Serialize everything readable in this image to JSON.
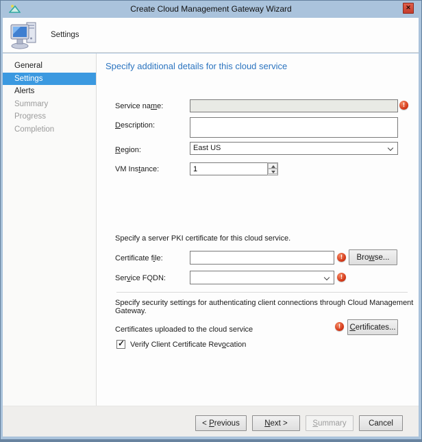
{
  "window": {
    "title": "Create Cloud Management Gateway Wizard"
  },
  "header": {
    "title": "Settings"
  },
  "sidebar": {
    "items": [
      {
        "label": "General",
        "state": "enabled"
      },
      {
        "label": "Settings",
        "state": "selected"
      },
      {
        "label": "Alerts",
        "state": "enabled"
      },
      {
        "label": "Summary",
        "state": "disabled"
      },
      {
        "label": "Progress",
        "state": "disabled"
      },
      {
        "label": "Completion",
        "state": "disabled"
      }
    ]
  },
  "content": {
    "heading": "Specify additional details for this cloud service",
    "rows": {
      "service_name": {
        "label": {
          "text": "Service name:",
          "u": 10
        },
        "value": "",
        "disabled": true,
        "error": true
      },
      "description": {
        "label": {
          "text": "Description:",
          "u": 0
        },
        "value": ""
      },
      "region": {
        "label": {
          "text": "Region:",
          "u": 0
        },
        "value": "East US"
      },
      "vm_instance": {
        "label": {
          "text": "VM Instance:",
          "u": 6
        },
        "value": "1"
      }
    },
    "pki": {
      "text": "Specify a server PKI certificate for this cloud service.",
      "certificate_file": {
        "label": {
          "text": "Certificate file:",
          "u": 13
        },
        "value": "",
        "error": true
      },
      "browse_button": {
        "text": "Browse...",
        "u": 3
      },
      "service_fqdn": {
        "label": {
          "text": "Service FQDN:",
          "u": 3
        },
        "value": "",
        "error": true
      }
    },
    "security": {
      "text": "Specify security settings for authenticating client connections through Cloud Management Gateway.",
      "certificates_row": {
        "label": "Certificates uploaded to the cloud service",
        "error": true
      },
      "certificates_button": {
        "text": "Certificates...",
        "u": 0
      },
      "revocation": {
        "label": {
          "text": "Verify Client Certificate Revocation",
          "u": 29
        },
        "checked": true
      }
    }
  },
  "footer": {
    "buttons": [
      {
        "text": "< Previous",
        "u": 2,
        "enabled": true
      },
      {
        "text": "Next >",
        "u": 0,
        "enabled": true
      },
      {
        "text": "Summary",
        "u": 0,
        "enabled": false
      },
      {
        "text": "Cancel",
        "u": -1,
        "enabled": true
      }
    ]
  },
  "colors": {
    "titlebar_blue": "#aac3dc",
    "selection_blue": "#3b99e0",
    "heading_blue": "#2b74c0",
    "error_red": "#d43818",
    "footer_gray": "#efeeec"
  }
}
